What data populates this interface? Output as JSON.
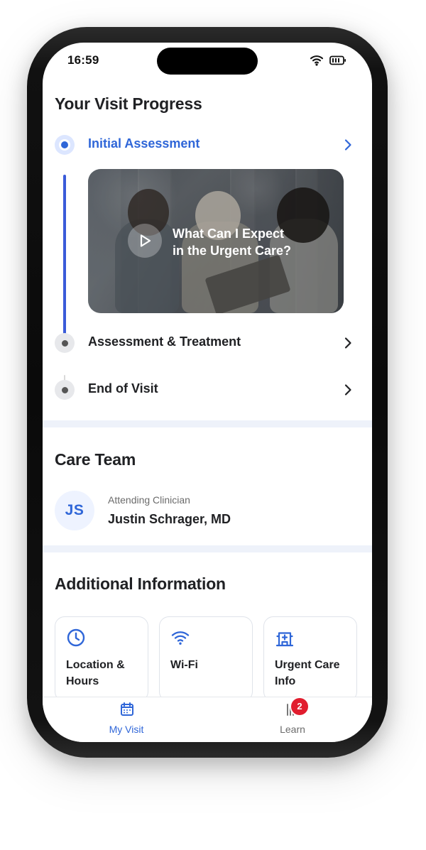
{
  "status_bar": {
    "time": "16:59",
    "icons": [
      "wifi-icon",
      "battery-icon"
    ]
  },
  "visit_progress": {
    "title": "Your Visit Progress",
    "steps": [
      {
        "label": "Initial Assessment",
        "state": "active"
      },
      {
        "label": "Assessment & Treatment",
        "state": "pending"
      },
      {
        "label": "End of Visit",
        "state": "pending"
      }
    ],
    "video": {
      "title_line_1": "What Can I Expect",
      "title_line_2": "in the Urgent Care?",
      "icon": "play-icon"
    }
  },
  "care_team": {
    "title": "Care Team",
    "avatar_initials": "JS",
    "role": "Attending Clinician",
    "name": "Justin Schrager, MD"
  },
  "additional_information": {
    "title": "Additional Information",
    "cards": [
      {
        "label_line_1": "Location &",
        "label_line_2": "Hours",
        "icon": "clock-icon"
      },
      {
        "label_line_1": "Wi-Fi",
        "label_line_2": "",
        "icon": "wifi-icon"
      },
      {
        "label_line_1": "Urgent Care",
        "label_line_2": "Info",
        "icon": "hospital-icon"
      }
    ]
  },
  "tab_bar": {
    "tabs": [
      {
        "label": "My Visit",
        "icon": "calendar-icon",
        "active": true
      },
      {
        "label": "Learn",
        "icon": "books-icon",
        "badge": "2",
        "active": false
      }
    ]
  },
  "colors": {
    "accent": "#2F66D8",
    "timeline": "#3A5BD9",
    "text": "#202124",
    "muted": "#6B6B6B",
    "divider": "#EEF2FA",
    "badge": "#E11D2E"
  }
}
